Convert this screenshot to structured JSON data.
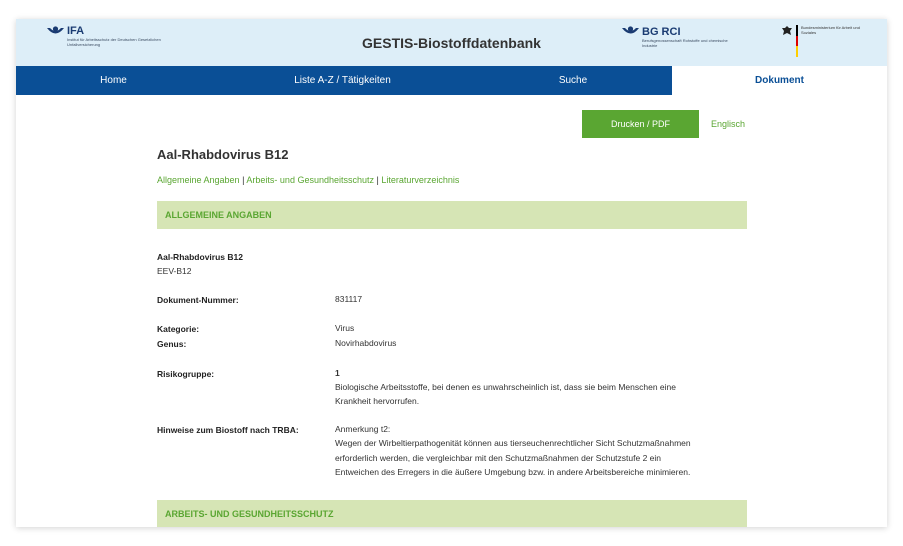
{
  "header": {
    "ifa_name": "IFA",
    "ifa_sub": "Institut für Arbeitsschutz der Deutschen Gesetzlichen Unfallversicherung",
    "title": "GESTIS-Biostoffdatenbank",
    "bgrci_name": "BG RCI",
    "bgrci_sub": "Berufsgenossenschaft Rohstoffe und chemische Industrie",
    "bmas_text": "Bundesministerium für Arbeit und Soziales"
  },
  "nav": {
    "home": "Home",
    "liste": "Liste A-Z / Tätigkeiten",
    "suche": "Suche",
    "dokument": "Dokument"
  },
  "actions": {
    "print": "Drucken / PDF",
    "language": "Englisch"
  },
  "document": {
    "title": "Aal-Rhabdovirus B12",
    "anchors": [
      "Allgemeine Angaben",
      "Arbeits- und Gesundheitsschutz",
      "Literaturverzeichnis"
    ],
    "anchor_sep": " | ",
    "section1": "ALLGEMEINE ANGABEN",
    "section2": "ARBEITS- UND GESUNDHEITSSCHUTZ",
    "name": "Aal-Rhabdovirus B12",
    "synonym": "EEV-B12",
    "docnum_label": "Dokument-Nummer:",
    "docnum_value": "831117",
    "kategorie_label": "Kategorie:",
    "kategorie_value": "Virus",
    "genus_label": "Genus:",
    "genus_value": "Novirhabdovirus",
    "risiko_label": "Risikogruppe:",
    "risiko_value": "1",
    "risiko_desc1": "Biologische Arbeitsstoffe, bei denen es unwahrscheinlich ist, dass sie beim Menschen eine",
    "risiko_desc2": "Krankheit hervorrufen.",
    "hinweise_label": "Hinweise zum Biostoff nach TRBA:",
    "hinweise_note": "Anmerkung t2:",
    "hinweise_line1": "Wegen der Wirbeltierpathogenität können aus tierseuchenrechtlicher Sicht Schutzmaßnahmen",
    "hinweise_line2": "erforderlich werden, die vergleichbar mit den Schutzmaßnahmen der Schutzstufe 2 ein",
    "hinweise_line3": "Entweichen des Erregers in die äußere Umgebung bzw. in andere Arbeitsbereiche minimieren."
  },
  "colors": {
    "nav": "#0a4f96",
    "accent_green": "#5aa632",
    "section_bg": "#d6e5b5",
    "header_bg": "#ddeef8"
  },
  "icons": [
    "ifa-logo-icon",
    "bgrci-logo-icon",
    "federal-eagle-icon"
  ]
}
